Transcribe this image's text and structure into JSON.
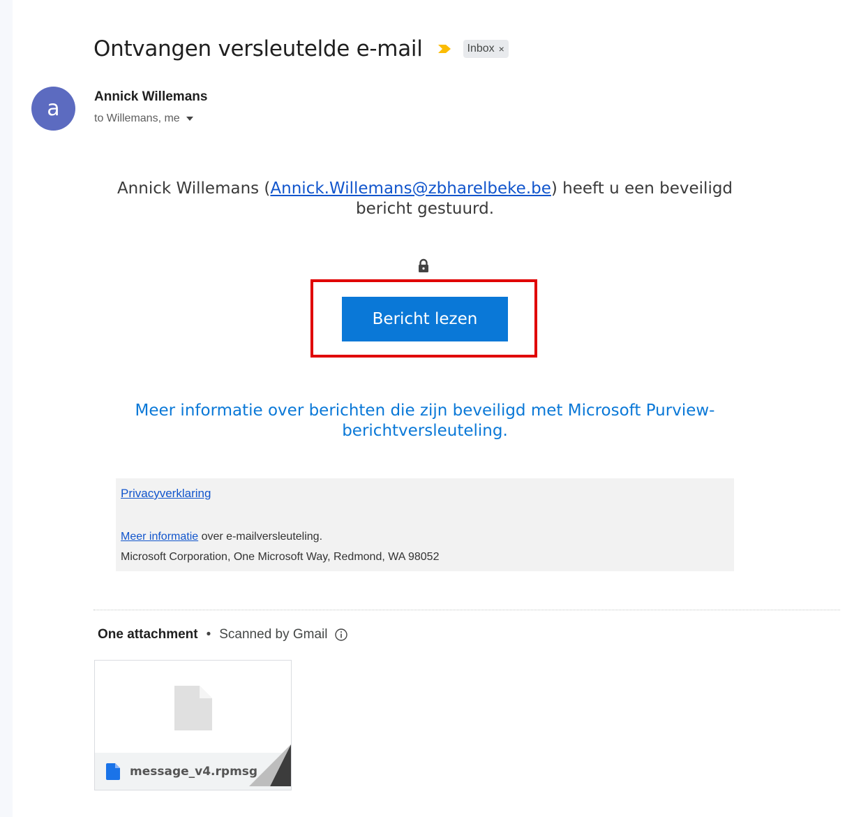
{
  "email": {
    "subject": "Ontvangen versleutelde e-mail",
    "label": "Inbox",
    "label_remove": "×",
    "importance_icon": "importance-marker-icon",
    "accent_color": "#fbbc04"
  },
  "sender": {
    "avatar_letter": "a",
    "avatar_color": "#5c6bc0",
    "name": "Annick Willemans",
    "recipients": "to Willemans, me"
  },
  "body": {
    "intro_prefix": "Annick Willemans (",
    "sender_email": "Annick.Willemans@zbharelbeke.be",
    "intro_suffix": ") heeft u een beveiligd bericht gestuurd.",
    "lock_icon": "lock-icon",
    "read_button": "Bericht lezen",
    "button_color": "#0a78d7",
    "highlight_color": "#e00000",
    "learn_more": "Meer informatie over berichten die zijn beveiligd met Microsoft Purview-berichtversleuteling."
  },
  "footer": {
    "privacy_link": "Privacyverklaring",
    "more_info_link": "Meer informatie",
    "more_info_suffix": " over e-mailversleuteling.",
    "address": "Microsoft Corporation, One Microsoft Way, Redmond, WA 98052"
  },
  "attachments": {
    "count_label": "One attachment",
    "separator": "•",
    "scanned_label": "Scanned by Gmail",
    "info_icon": "info-icon",
    "files": [
      {
        "name": "message_v4.rpmsg",
        "icon": "document-icon"
      }
    ]
  }
}
